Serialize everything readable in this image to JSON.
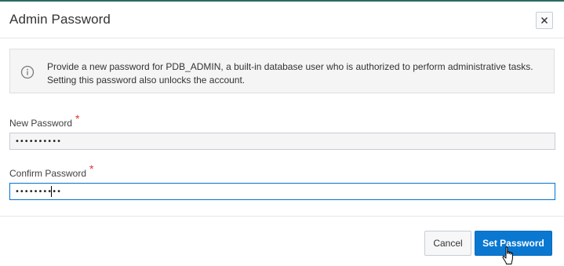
{
  "dialog": {
    "title": "Admin Password",
    "close_icon": "close-icon"
  },
  "info": {
    "icon": "info-icon",
    "text_line1": "Provide a new password for PDB_ADMIN, a built-in database user who is authorized to perform administrative tasks.",
    "text_line2": "Setting this password also unlocks the account."
  },
  "form": {
    "new_password": {
      "label": "New Password",
      "required_mark": "*",
      "value": "••••••••••"
    },
    "confirm_password": {
      "label": "Confirm Password",
      "required_mark": "*",
      "value": "••••••••••"
    }
  },
  "footer": {
    "cancel_label": "Cancel",
    "submit_label": "Set Password"
  },
  "colors": {
    "primary": "#0a78d1",
    "accent_top": "#2b6a62",
    "required": "#e03232",
    "focus_border": "#0572ce"
  }
}
